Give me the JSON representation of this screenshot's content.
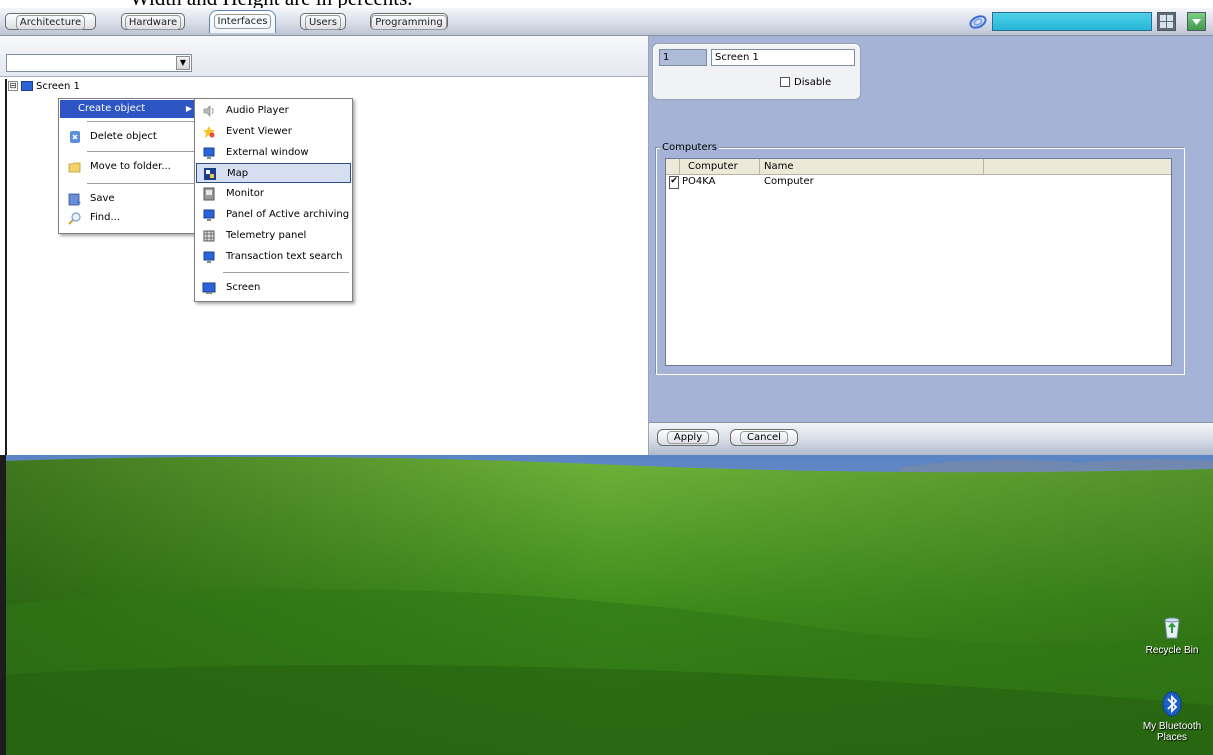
{
  "caption": {
    "text": "Width and Height are in percents."
  },
  "tabs": [
    {
      "label": "Architecture",
      "active": false
    },
    {
      "label": "Hardware",
      "active": false
    },
    {
      "label": "Interfaces",
      "active": true
    },
    {
      "label": "Users",
      "active": false
    },
    {
      "label": "Programming",
      "active": false
    }
  ],
  "tree": {
    "root_label": "Screen 1",
    "expander": "⊟"
  },
  "combo": {
    "value": "",
    "arrow": "▼"
  },
  "context_menu": {
    "items": [
      {
        "label": "Create object",
        "icon": "none",
        "has_submenu": true,
        "highlighted": true
      },
      {
        "label": "Delete object",
        "icon": "delete-icon"
      },
      {
        "label": "Move to folder...",
        "icon": "folder-icon"
      },
      {
        "label": "Save",
        "icon": "save-icon"
      },
      {
        "label": "Find...",
        "icon": "find-icon"
      }
    ],
    "submenu_arrow": "▶"
  },
  "submenu": {
    "items": [
      {
        "label": "Audio Player",
        "icon": "speaker-icon"
      },
      {
        "label": "Event Viewer",
        "icon": "event-icon"
      },
      {
        "label": "External window",
        "icon": "window-icon"
      },
      {
        "label": "Map",
        "icon": "map-icon",
        "highlighted": true
      },
      {
        "label": "Monitor",
        "icon": "monitor-icon"
      },
      {
        "label": "Panel of Active archiving",
        "icon": "archive-icon"
      },
      {
        "label": "Telemetry panel",
        "icon": "telemetry-icon"
      },
      {
        "label": "Transaction text search",
        "icon": "search-icon"
      },
      {
        "label": "Screen",
        "icon": "screen-icon"
      }
    ]
  },
  "properties": {
    "id_value": "1",
    "name_value": "Screen 1",
    "disable_label": "Disable",
    "disable_checked": false
  },
  "computers": {
    "group_title": "Computers",
    "columns": [
      "Computer",
      "Name"
    ],
    "rows": [
      {
        "checked": true,
        "computer": "PO4KA",
        "name": "Computer"
      }
    ],
    "check_mark": "✔"
  },
  "buttons": {
    "apply": "Apply",
    "cancel": "Cancel"
  },
  "desktop": {
    "icons": [
      {
        "label": "Recycle Bin",
        "icon": "recycle-bin-icon"
      },
      {
        "label": "My Bluetooth Places",
        "icon": "bluetooth-icon"
      }
    ]
  },
  "colors": {
    "panel_bg": "#a5b3d7",
    "highlight": "#2d56c4",
    "top_field": "#27b6d8",
    "sky": "#6f95c9",
    "grass": "#3e8a1c"
  }
}
